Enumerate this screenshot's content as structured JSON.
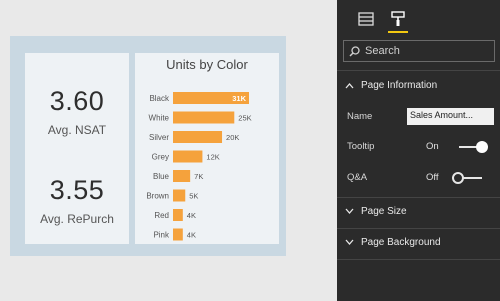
{
  "cards": {
    "nsat": {
      "value": "3.60",
      "label": "Avg. NSAT"
    },
    "repurch": {
      "value": "3.55",
      "label": "Avg. RePurch"
    }
  },
  "chart_data": {
    "type": "bar",
    "orientation": "horizontal",
    "title": "Units by Color",
    "categories": [
      "Black",
      "White",
      "Silver",
      "Grey",
      "Blue",
      "Brown",
      "Red",
      "Pink"
    ],
    "values": [
      31000,
      25000,
      20000,
      12000,
      7000,
      5000,
      4000,
      4000
    ],
    "data_labels": [
      "31K",
      "25K",
      "20K",
      "12K",
      "7K",
      "5K",
      "4K",
      "4K"
    ],
    "bar_color": "#f5a23c",
    "xlim": [
      0,
      31000
    ]
  },
  "pane": {
    "tabs": {
      "fields_icon": "fields-icon",
      "format_icon": "paint-roller-icon"
    },
    "search_placeholder": "Search",
    "page_information": {
      "title": "Page Information",
      "name_label": "Name",
      "name_value": "Sales Amount...",
      "tooltip_label": "Tooltip",
      "tooltip_state": "On",
      "qa_label": "Q&A",
      "qa_state": "Off"
    },
    "page_size": {
      "title": "Page Size"
    },
    "page_background": {
      "title": "Page Background"
    },
    "accent_color": "#f2c811"
  }
}
